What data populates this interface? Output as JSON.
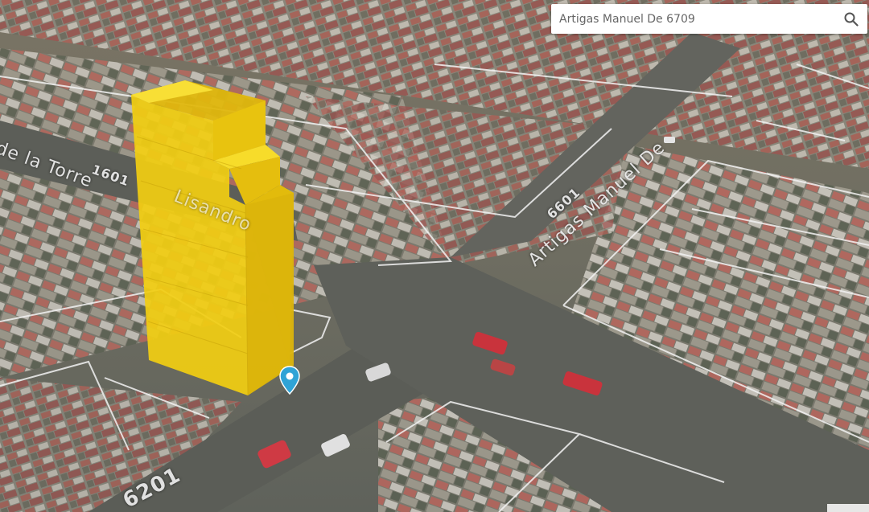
{
  "search": {
    "value": "Artigas Manuel De 6709",
    "icon": "search-icon"
  },
  "labels": {
    "street_main": "Artigas Manuel De",
    "street_main_number": "6601",
    "street_left": "de la Torre",
    "street_left_number": "1601",
    "street_mid": "Lisandro",
    "corner_number": "6201"
  },
  "pin": {
    "icon": "map-pin-icon",
    "color": "#2fa3d6"
  },
  "colors": {
    "building": "#f2c811",
    "roof_red": "#b35d56",
    "outline": "#f4f4f4"
  }
}
